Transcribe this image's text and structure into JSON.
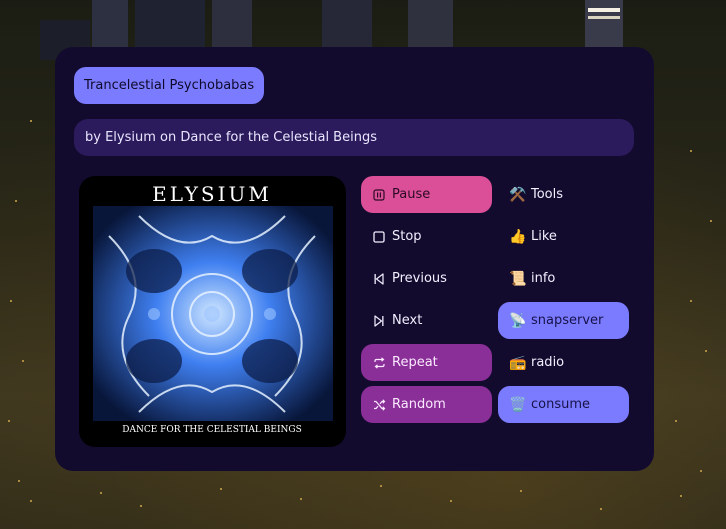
{
  "track": {
    "title": "Trancelestial Psychobabas",
    "subtitle": "by Elysium on Dance for the Celestial Beings"
  },
  "album_art": {
    "band_text": "ELYSIUM",
    "album_text": "DANCE FOR THE CELESTIAL BEINGS"
  },
  "controls": [
    {
      "label": "Pause",
      "icon": "pause-icon"
    },
    {
      "label": "Stop",
      "icon": "stop-icon"
    },
    {
      "label": "Previous",
      "icon": "skip-previous-icon"
    },
    {
      "label": "Next",
      "icon": "skip-next-icon"
    },
    {
      "label": "Repeat",
      "icon": "repeat-icon"
    },
    {
      "label": "Random",
      "icon": "shuffle-icon"
    }
  ],
  "actions": [
    {
      "label": "Tools",
      "icon": "hammer-pick-icon",
      "glyph": "⚒️"
    },
    {
      "label": "Like",
      "icon": "thumbs-up-icon",
      "glyph": "👍"
    },
    {
      "label": "info",
      "icon": "scroll-icon",
      "glyph": "📜"
    },
    {
      "label": "snapserver",
      "icon": "satellite-antenna-icon",
      "glyph": "📡"
    },
    {
      "label": "radio",
      "icon": "radio-icon",
      "glyph": "📻"
    },
    {
      "label": "consume",
      "icon": "trash-icon",
      "glyph": "🗑️"
    }
  ],
  "colors": {
    "card": "#130b2e",
    "title_pill": "#7b7bff",
    "subtitle_bar": "#2b1a5c",
    "pause_active": "#db4f98",
    "toggle_on": "#8a2f98",
    "action_on": "#7b7bff"
  }
}
